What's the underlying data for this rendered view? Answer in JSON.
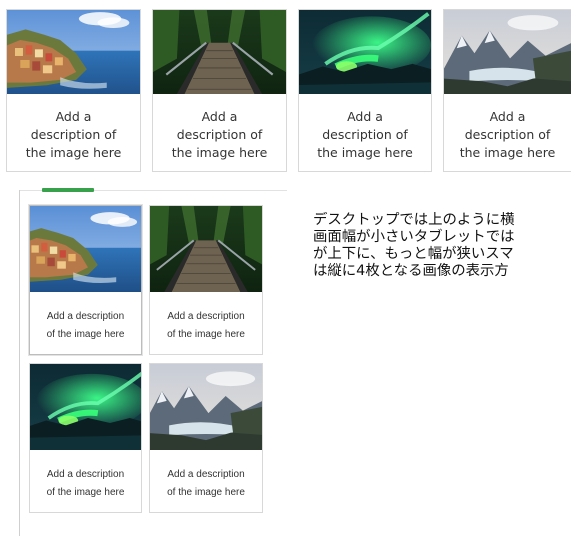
{
  "top_gallery": [
    {
      "image": "coastal-village-photo",
      "caption_lines": [
        "Add a",
        "description of",
        "the image here"
      ]
    },
    {
      "image": "forest-bridge-photo",
      "caption_lines": [
        "Add a",
        "description of",
        "the image here"
      ]
    },
    {
      "image": "aurora-photo",
      "caption_lines": [
        "Add a",
        "description of",
        "the image here"
      ]
    },
    {
      "image": "mountain-lake-photo",
      "caption_lines": [
        "Add a",
        "description of",
        "the image here"
      ]
    }
  ],
  "tablet_gallery": [
    {
      "image": "coastal-village-photo",
      "caption_lines": [
        "Add a description",
        "of the image here"
      ]
    },
    {
      "image": "forest-bridge-photo",
      "caption_lines": [
        "Add a description",
        "of the image here"
      ]
    },
    {
      "image": "aurora-photo",
      "caption_lines": [
        "Add a description",
        "of the image here"
      ]
    },
    {
      "image": "mountain-lake-photo",
      "caption_lines": [
        "Add a description",
        "of the image here"
      ]
    }
  ],
  "explanation_lines": [
    "デスクトップでは上のように横",
    "画面幅が小さいタブレットでは",
    "が上下に、もっと幅が狭いスマ",
    "は縦に4枚となる画像の表示方"
  ],
  "colors": {
    "accent": "#37a24b",
    "card_border": "#d8d8d8",
    "text": "#333333"
  }
}
